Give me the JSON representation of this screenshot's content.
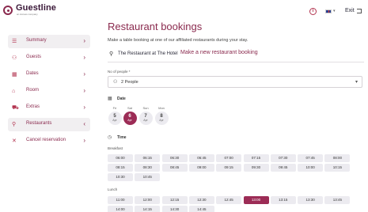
{
  "header": {
    "logo_name": "Guestline",
    "logo_sub": "an Access company",
    "language_flag": "flag-uk-icon",
    "exit_label": "Exit"
  },
  "sidebar": {
    "items": [
      {
        "label": "Summary",
        "icon": "list-icon",
        "active": true
      },
      {
        "label": "Guests",
        "icon": "people-icon",
        "active": false
      },
      {
        "label": "Dates",
        "icon": "calendar-icon",
        "active": false
      },
      {
        "label": "Room",
        "icon": "bed-icon",
        "active": false
      },
      {
        "label": "Extras",
        "icon": "cart-icon",
        "active": false
      },
      {
        "label": "Restaurants",
        "icon": "cutlery-icon",
        "active": true
      },
      {
        "label": "Cancel reservation",
        "icon": "close-icon",
        "active": false
      }
    ]
  },
  "main": {
    "title": "Restaurant bookings",
    "intro": "Make a table booking at one of our affiliated restaurants during your stay.",
    "tab_hotel": "The Restaurant at The Hotel",
    "tab_new": "Make a new restaurant booking",
    "people_label": "No of people *",
    "people_value": "2 People",
    "date_section_label": "Date",
    "dates": [
      {
        "dow": "Fri",
        "day": "5",
        "month": "Apr",
        "selected": false
      },
      {
        "dow": "Sat",
        "day": "6",
        "month": "Apr",
        "selected": true
      },
      {
        "dow": "Sun",
        "day": "7",
        "month": "Apr",
        "selected": false
      },
      {
        "dow": "Mon",
        "day": "8",
        "month": "Apr",
        "selected": false
      }
    ],
    "time_section_label": "Time",
    "breakfast_label": "Breakfast",
    "breakfast_slots": [
      "06:00",
      "06:15",
      "06:30",
      "06:45",
      "07:00",
      "07:15",
      "07:30",
      "07:45",
      "08:00",
      "08:15",
      "08:30",
      "08:45",
      "09:00",
      "09:15",
      "09:30",
      "09:45",
      "10:00",
      "10:15",
      "10:30",
      "10:45"
    ],
    "lunch_label": "Lunch",
    "lunch_slots": [
      "11:00",
      "12:00",
      "12:15",
      "12:30",
      "12:45",
      "13:00",
      "13:15",
      "13:30",
      "13:45",
      "14:00",
      "14:15",
      "14:30",
      "14:45"
    ],
    "lunch_selected": "13:00",
    "colors": {
      "accent": "#8a2a4e",
      "selected": "#9c2c56",
      "slot_bg": "#ecebf0",
      "nav_active": "#f1eff1"
    }
  }
}
